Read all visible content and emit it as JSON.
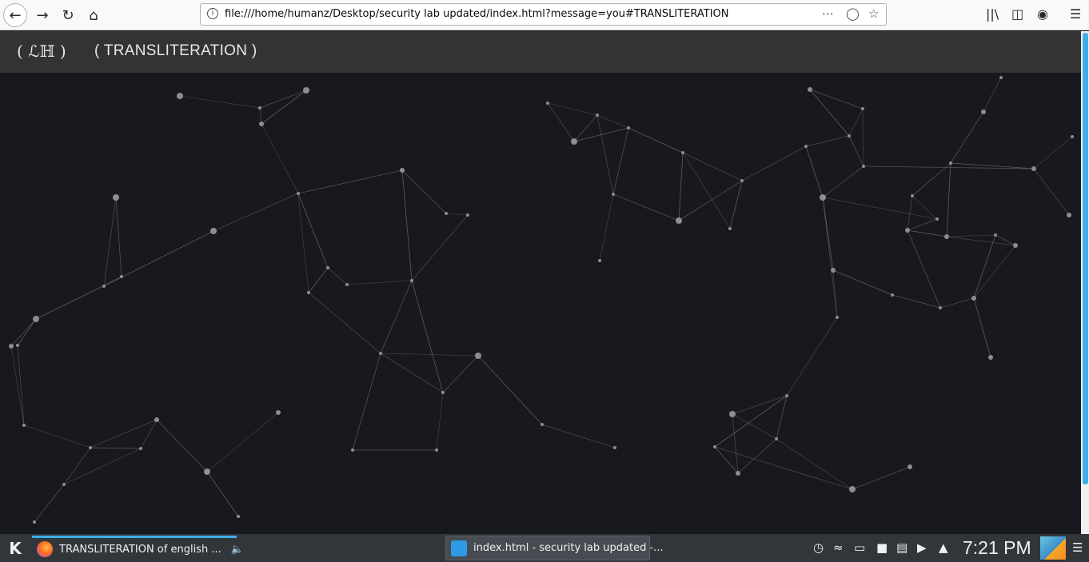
{
  "browser": {
    "url": "file:///home/humanz/Desktop/security lab updated/index.html?message=you#TRANSLITERATION"
  },
  "header": {
    "logo": "( ℒℍ )",
    "nav_item": "( TRANSLITERATION )"
  },
  "taskbar": {
    "tasks": [
      {
        "label": "TRANSLITERATION of english ..."
      },
      {
        "label": "index.html - security lab updated -..."
      }
    ],
    "clock": "7:21 PM"
  },
  "colors": {
    "page_bg": "#18181f",
    "header_bg": "#333336",
    "node": "#8d8d93",
    "edge": "#6a6a70",
    "accent": "#3daee9"
  },
  "icons": [
    "back-arrow-icon",
    "forward-arrow-icon",
    "reload-icon",
    "home-icon",
    "info-icon",
    "more-icon",
    "pocket-icon",
    "bookmark-star-icon",
    "library-icon",
    "sidebar-icon",
    "account-icon",
    "menu-icon",
    "kde-launcher-icon",
    "firefox-icon",
    "speaker-icon",
    "vscode-icon",
    "update-icon",
    "wifi-icon",
    "battery-icon",
    "lock-icon",
    "clipboard-icon",
    "volume-icon",
    "tray-expand-icon"
  ]
}
